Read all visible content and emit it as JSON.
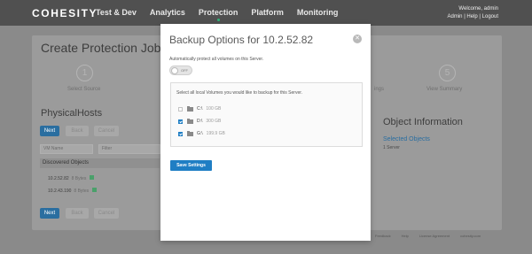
{
  "header": {
    "logo": "COHESITY",
    "nav": [
      "Test & Dev",
      "Analytics",
      "Protection",
      "Platform",
      "Monitoring"
    ],
    "welcome": "Welcome, admin",
    "links": "Admin  |  Help  |  Logout"
  },
  "page": {
    "title": "Create Protection Job",
    "steps": [
      {
        "num": "1",
        "label": "Select Source"
      },
      {
        "num": "5",
        "label": "View Summary"
      }
    ],
    "partial_step_label": "ings",
    "partial_left_label": "S",
    "physical_hosts_title": "PhysicalHosts",
    "buttons": {
      "next": "Next",
      "back": "Back",
      "cancel": "Cancel"
    },
    "view_name_placeholder": "VM Name",
    "filter_placeholder": "Filter",
    "discovered_label": "Discovered Objects",
    "hosts": [
      {
        "ip": "10.2.52.82",
        "size": "8 Bytes"
      },
      {
        "ip": "10.2.43.190",
        "size": "8 Bytes"
      }
    ],
    "object_info_title": "Object Information",
    "selected_objects_label": "Selected Objects",
    "selected_count": "1 Server",
    "footer_links": [
      "Feedback",
      "Help",
      "License Agreement",
      "cohesity.com"
    ]
  },
  "modal": {
    "title": "Backup Options for 10.2.52.82",
    "close_glyph": "✕",
    "auto_protect_label": "Automatically protect all volumes on this Server.",
    "toggle_text": "OFF",
    "volumes_header": "Select all local Volumes you would like to backup for this Server.",
    "volumes": [
      {
        "name": "C:\\",
        "size": "100 GB",
        "checked": false
      },
      {
        "name": "D:\\",
        "size": "300 GB",
        "checked": true
      },
      {
        "name": "G:\\",
        "size": "199.9 GB",
        "checked": true
      }
    ],
    "save_button": "Save Settings"
  },
  "colors": {
    "accent": "#1f7ec4",
    "topbar": "#505050",
    "nav_indicator": "#2fb57a"
  }
}
